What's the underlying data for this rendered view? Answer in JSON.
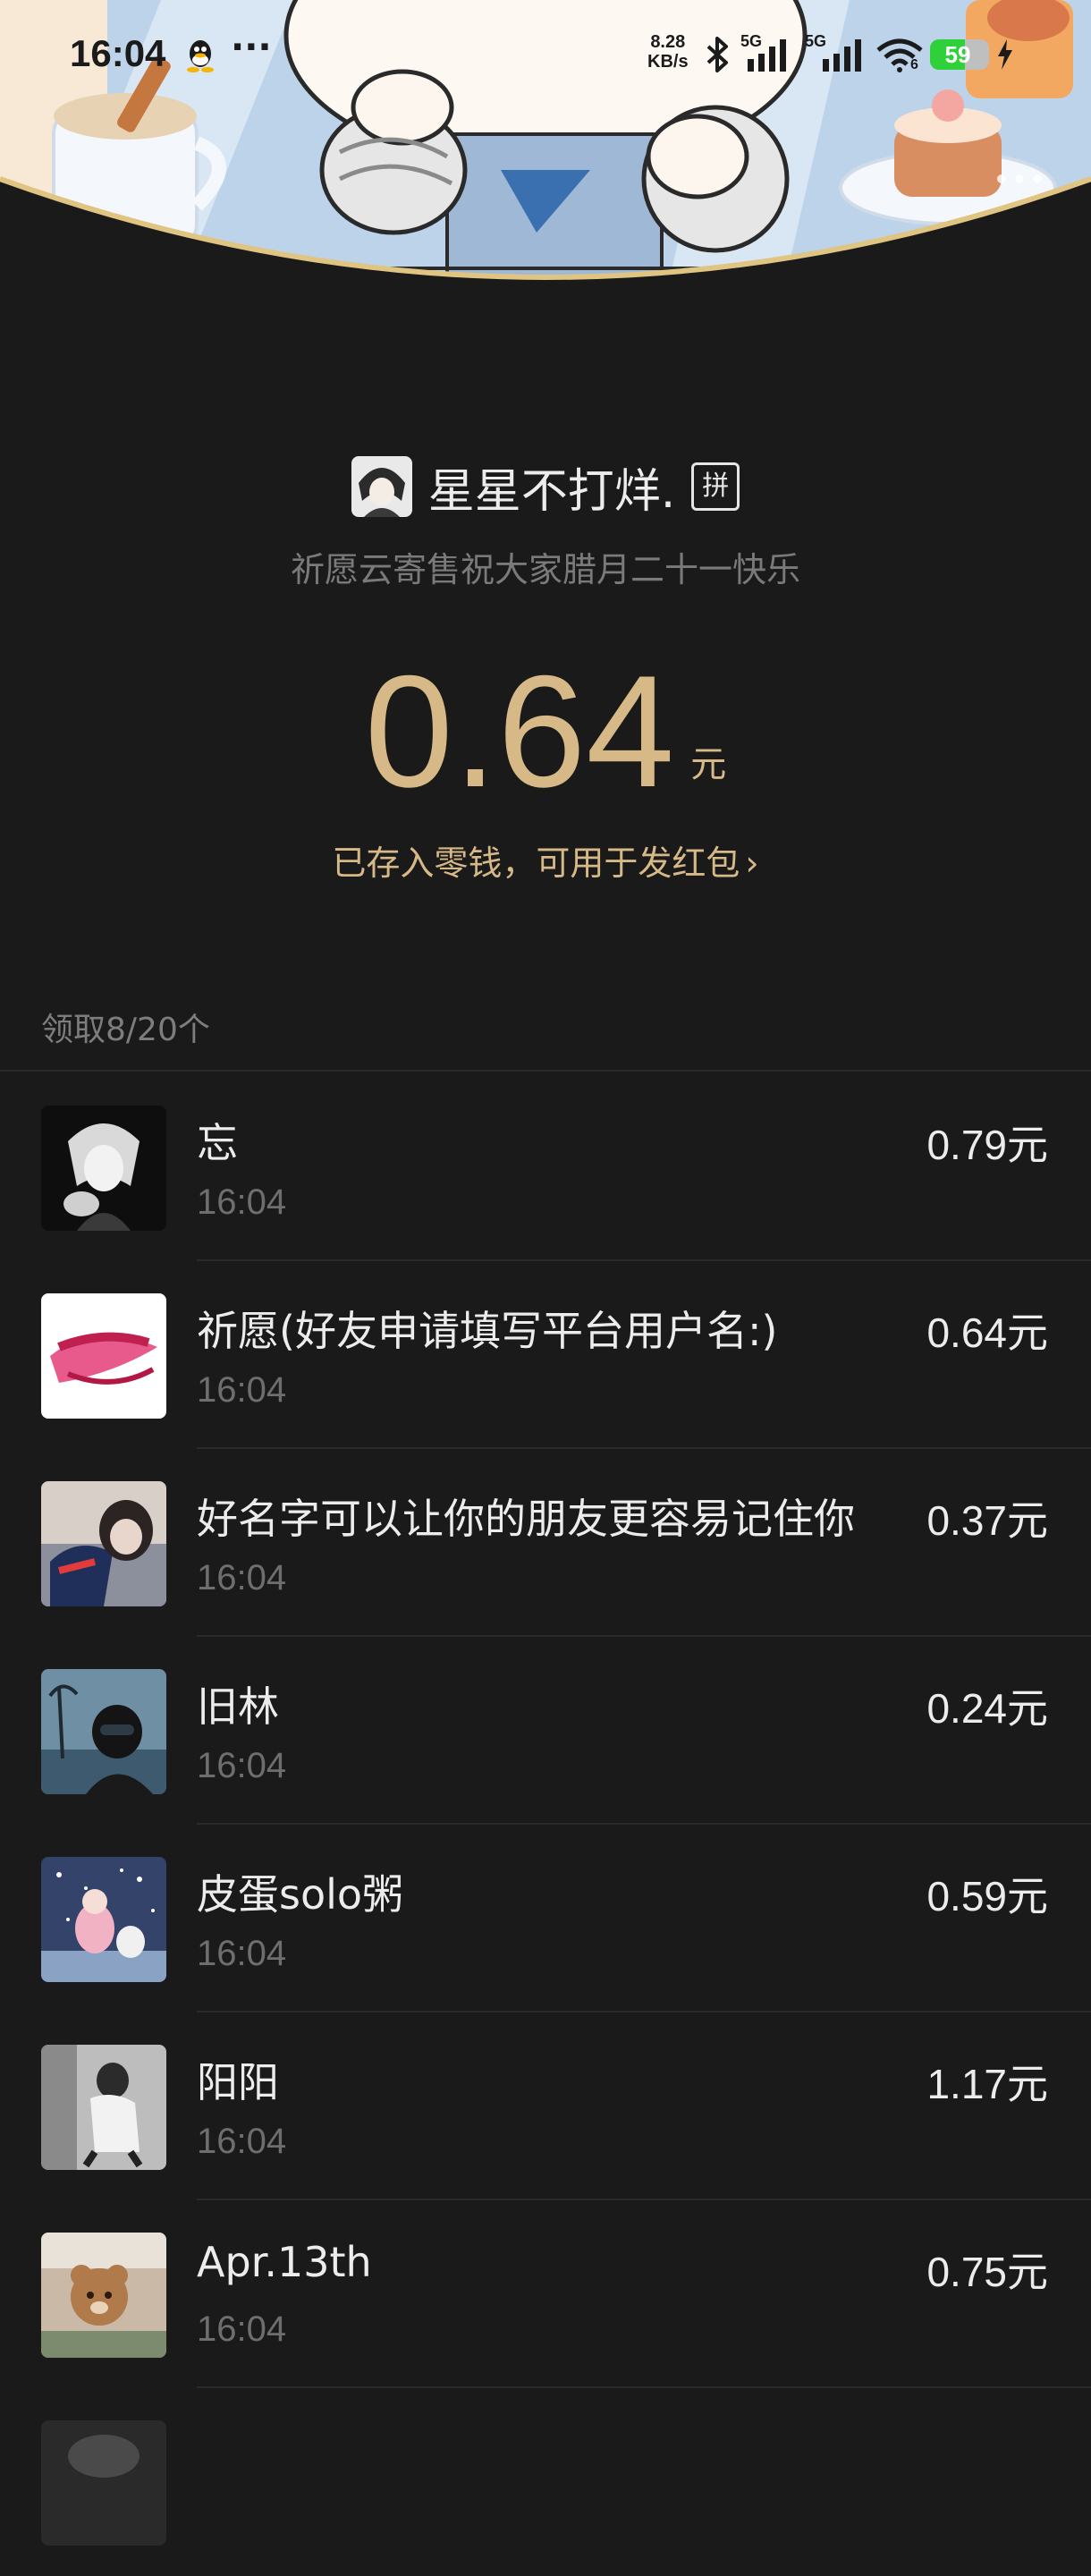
{
  "status_bar": {
    "time": "16:04",
    "more": "···",
    "net_speed_value": "8.28",
    "net_speed_unit": "KB/s",
    "sim1": "5G",
    "sim2": "5G",
    "wifi_badge": "6",
    "battery_level": 59,
    "battery_text": "59",
    "icons": [
      "qq-icon",
      "bluetooth-icon",
      "signal-icon",
      "signal-icon",
      "wifi-icon",
      "battery-icon",
      "charging-icon"
    ]
  },
  "banner": {
    "colors": {
      "sky": "#bcd3ea",
      "gold_border": "#e0c482",
      "cream": "#fdf6ee"
    }
  },
  "header": {
    "sender_name": "星星不打烊.",
    "badge": "拼",
    "greeting": "祈愿云寄售祝大家腊月二十一快乐",
    "amount": "0.64",
    "unit": "元",
    "stored_text": "已存入零钱，可用于发红包",
    "stored_chevron": "›"
  },
  "count_text": "领取8/20个",
  "colors": {
    "background": "#1a1a1a",
    "gold": "#d7b987",
    "text": "#ececec",
    "muted": "#6e6e6e"
  },
  "recipients": [
    {
      "name": "忘",
      "time": "16:04",
      "amount": "0.79元",
      "avatar": "anime-avatar"
    },
    {
      "name": "祈愿(好友申请填写平台用户名:)",
      "time": "16:04",
      "amount": "0.64元",
      "avatar": "logo-avatar"
    },
    {
      "name": "好名字可以让你的朋友更容易记住你",
      "time": "16:04",
      "amount": "0.37元",
      "avatar": "photo-avatar"
    },
    {
      "name": "旧林",
      "time": "16:04",
      "amount": "0.24元",
      "avatar": "photo-avatar"
    },
    {
      "name": "皮蛋solo粥",
      "time": "16:04",
      "amount": "0.59元",
      "avatar": "photo-avatar"
    },
    {
      "name": "阳阳",
      "time": "16:04",
      "amount": "1.17元",
      "avatar": "photo-avatar"
    },
    {
      "name": "Apr.13th",
      "time": "16:04",
      "amount": "0.75元",
      "avatar": "photo-avatar"
    }
  ]
}
